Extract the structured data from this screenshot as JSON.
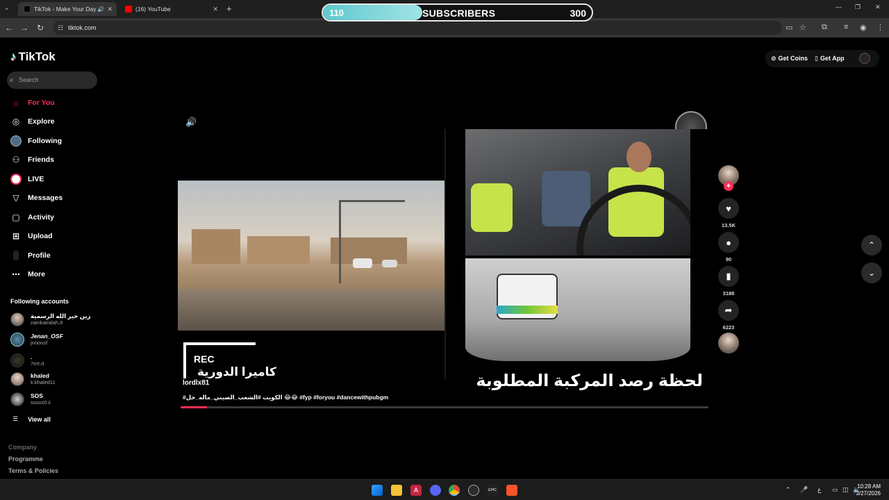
{
  "browser": {
    "tabs": [
      {
        "title": "TikTok - Make Your Day",
        "active": true
      },
      {
        "title": "(16) YouTube",
        "active": false
      }
    ],
    "new_tab": "+",
    "url": "tiktok.com",
    "window_controls": [
      "—",
      "❐",
      "✕"
    ]
  },
  "subscribers": {
    "current": "110",
    "label": "SUBSCRIBERS",
    "goal": "300",
    "progress_fraction": 0.37
  },
  "tiktok": {
    "logo": "TikTok",
    "search_placeholder": "Search",
    "nav": [
      {
        "label": "For You",
        "icon": "home-icon",
        "active": true
      },
      {
        "label": "Explore",
        "icon": "compass-icon"
      },
      {
        "label": "Following",
        "icon": "following-avatar-icon"
      },
      {
        "label": "Friends",
        "icon": "friends-icon"
      },
      {
        "label": "LIVE",
        "icon": "live-icon"
      },
      {
        "label": "Messages",
        "icon": "messages-icon"
      },
      {
        "label": "Activity",
        "icon": "activity-icon"
      },
      {
        "label": "Upload",
        "icon": "upload-icon"
      },
      {
        "label": "Profile",
        "icon": "profile-icon"
      },
      {
        "label": "More",
        "icon": "more-icon"
      }
    ],
    "following_title": "Following accounts",
    "accounts": [
      {
        "name": "زين خير الله الرسمية",
        "handle": "zainkairalah.8"
      },
      {
        "name": "Jenan_OSF",
        "handle": "jnooosf"
      },
      {
        "name": ".",
        "handle": "7ert.d"
      },
      {
        "name": "khaled",
        "handle": "k.khaled11"
      },
      {
        "name": "SOS",
        "handle": "sosxz0.ii"
      }
    ],
    "view_all": "View all",
    "footer": [
      "Company",
      "Programme",
      "Terms & Policies"
    ],
    "top_buttons": {
      "coins": "Get Coins",
      "app": "Get App"
    }
  },
  "video": {
    "rec": "REC",
    "cam_label": "كاميرا الدورية",
    "main_caption": "لحظة رصد المركبة المطلوبة",
    "username": "lordlx81",
    "description": "#الكويت #الشعب_الصيني_ماله_حل 😂😂 #fyp #foryou #dancewithpubgm",
    "progress_fraction": 0.05
  },
  "actions": {
    "likes": "13.5K",
    "comments": "90",
    "saves": "3188",
    "shares": "6223"
  },
  "taskbar": {
    "time": "10:28 AM",
    "date": "3/27/2026",
    "lang": "ع"
  }
}
